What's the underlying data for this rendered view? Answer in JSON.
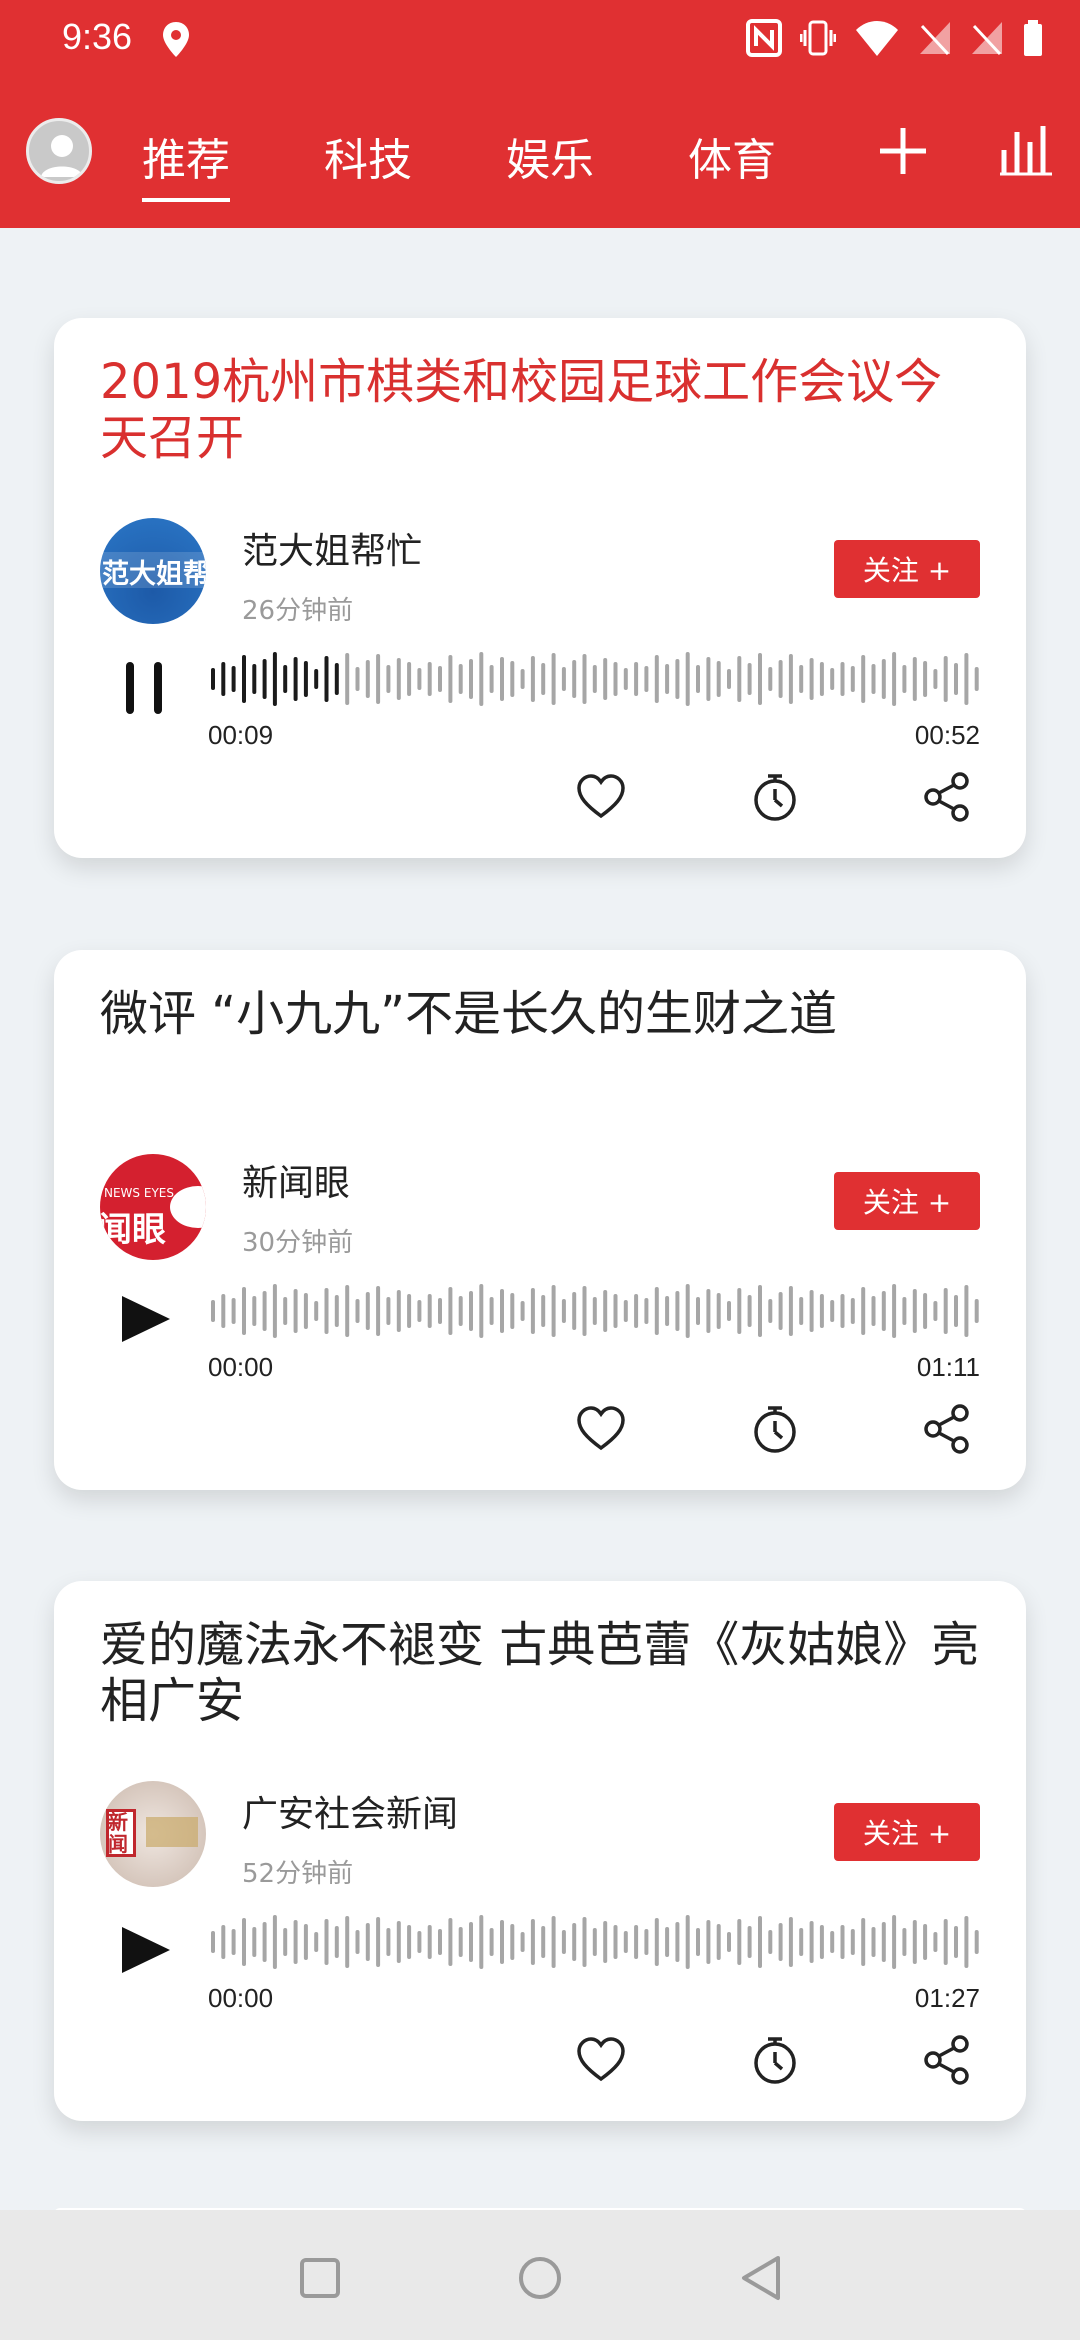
{
  "status_bar": {
    "time": "9:36"
  },
  "nav": {
    "tabs": [
      "推荐",
      "科技",
      "娱乐",
      "体育"
    ],
    "active_tab_index": 0,
    "accent_color": "#e03032"
  },
  "cards": [
    {
      "title": "2019杭州市棋类和校园足球工作会议今天召开",
      "title_highlighted": true,
      "source_name": "范大姐帮忙",
      "source_logo_text": "范大姐帮",
      "time_ago": "26分钟前",
      "follow_label": "关注 +",
      "state": "playing",
      "elapsed": "00:09",
      "duration": "00:52",
      "progress": 0.17
    },
    {
      "title": "微评 “小九九”不是长久的生财之道",
      "title_highlighted": false,
      "source_name": "新闻眼",
      "source_logo_text": "闻眼",
      "source_logo_subtext": "NEWS EYES",
      "time_ago": "30分钟前",
      "follow_label": "关注 +",
      "state": "paused",
      "elapsed": "00:00",
      "duration": "01:11",
      "progress": 0
    },
    {
      "title": "爱的魔法永不褪变 古典芭蕾《灰姑娘》亮相广安",
      "title_highlighted": false,
      "source_name": "广安社会新闻",
      "source_logo_text": "新闻",
      "time_ago": "52分钟前",
      "follow_label": "关注 +",
      "state": "paused",
      "elapsed": "00:00",
      "duration": "01:27",
      "progress": 0
    }
  ],
  "card_actions": [
    "like-icon",
    "timer-icon",
    "share-icon"
  ],
  "bottom_nav": [
    "recents-icon",
    "home-icon",
    "back-icon"
  ]
}
